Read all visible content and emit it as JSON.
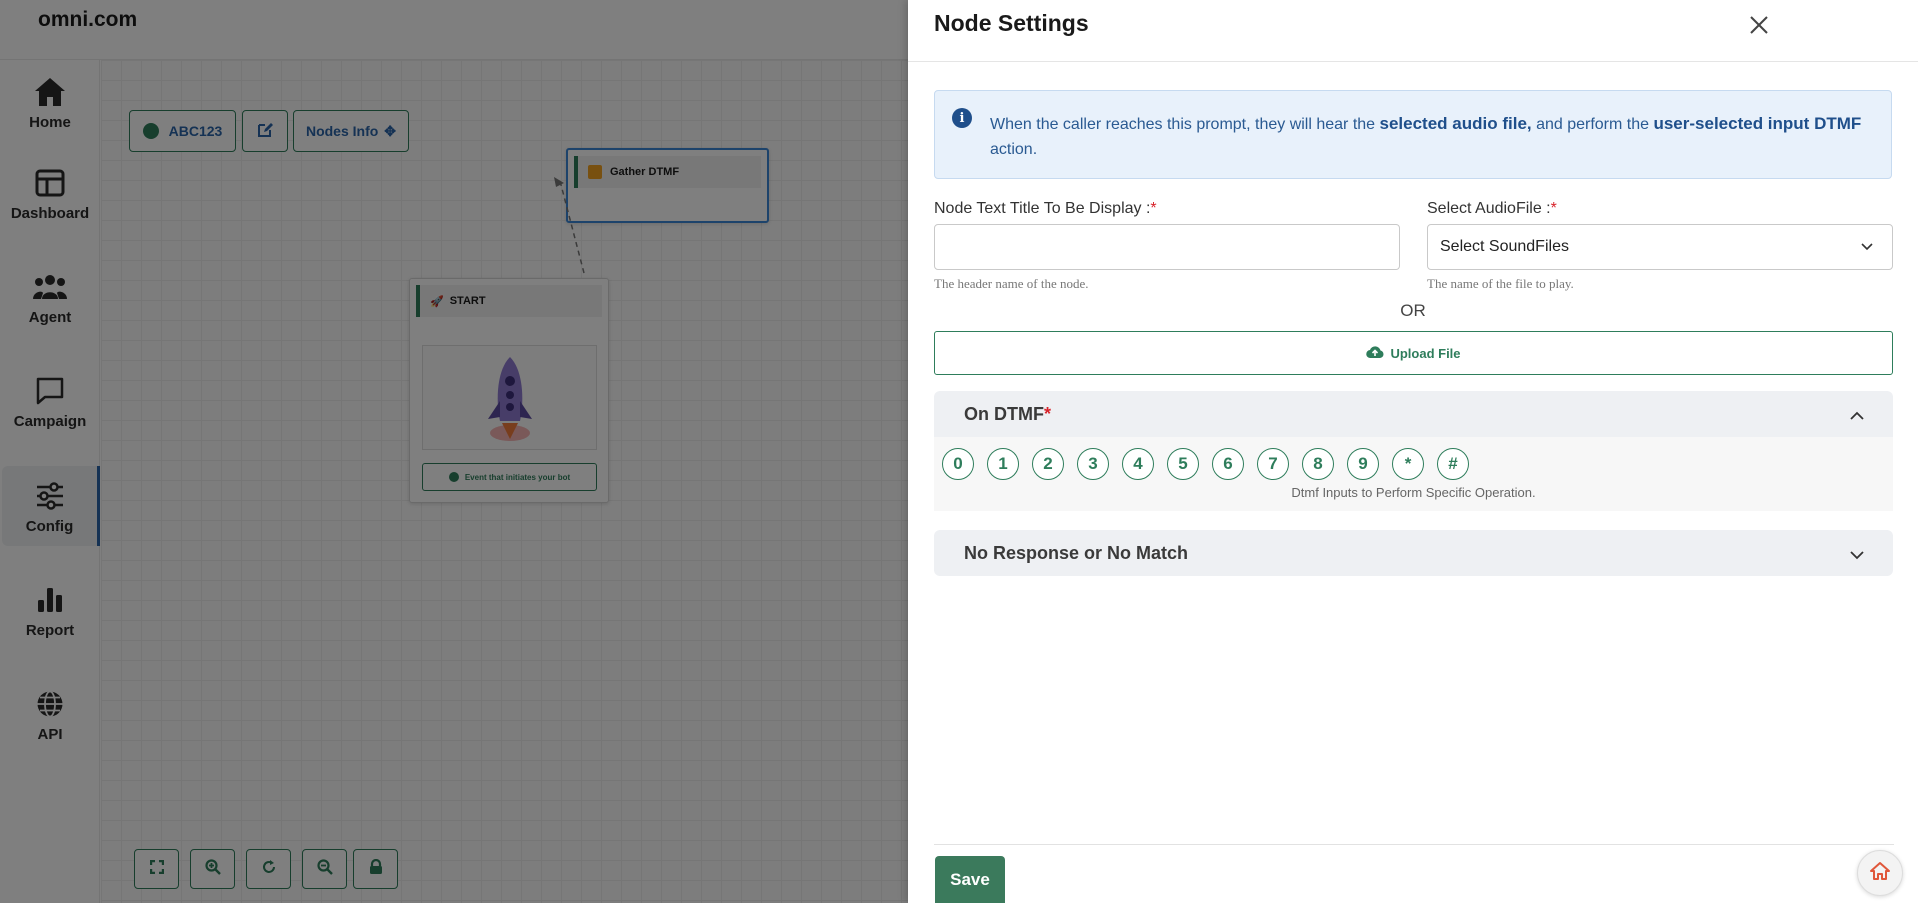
{
  "app": {
    "logo": "omni.com"
  },
  "sidebar": {
    "items": [
      {
        "label": "Home",
        "icon": "home-icon"
      },
      {
        "label": "Dashboard",
        "icon": "dashboard-icon"
      },
      {
        "label": "Agent",
        "icon": "users-icon"
      },
      {
        "label": "Campaign",
        "icon": "chat-icon"
      },
      {
        "label": "Config",
        "icon": "sliders-icon",
        "active": true
      },
      {
        "label": "Report",
        "icon": "bar-chart-icon"
      },
      {
        "label": "API",
        "icon": "globe-icon"
      }
    ]
  },
  "canvas": {
    "toolbar": {
      "flow_name": "ABC123",
      "nodes_info_label": "Nodes Info"
    },
    "nodes": {
      "gather": {
        "title": "Gather DTMF"
      },
      "start": {
        "title": "START",
        "event_label": "Event that initiates your bot"
      }
    }
  },
  "panel": {
    "title": "Node Settings",
    "info": {
      "part1": "When the caller reaches this prompt, they will hear the ",
      "bold1": "selected audio file,",
      "part2": " and perform the ",
      "bold2": "user-selected input DTMF",
      "part3": " action."
    },
    "node_title": {
      "label": "Node Text Title To Be Display :",
      "required_mark": "*",
      "value": "",
      "hint": "The header name of the node."
    },
    "audio": {
      "label": "Select AudioFile :",
      "required_mark": "*",
      "selected": "Select SoundFiles",
      "hint": "The name of the file to play."
    },
    "or_label": "OR",
    "upload_label": "Upload File",
    "on_dtmf": {
      "title": "On DTMF",
      "required_mark": "*",
      "expanded": true,
      "keys": [
        "0",
        "1",
        "2",
        "3",
        "4",
        "5",
        "6",
        "7",
        "8",
        "9",
        "*",
        "#"
      ],
      "hint": "Dtmf Inputs to Perform Specific Operation."
    },
    "no_response": {
      "title": "No Response or No Match",
      "expanded": false
    },
    "save_label": "Save"
  },
  "colors": {
    "brand_green": "#2e7d5b",
    "info_blue": "#1f4f8b",
    "required_red": "#d8232a"
  }
}
